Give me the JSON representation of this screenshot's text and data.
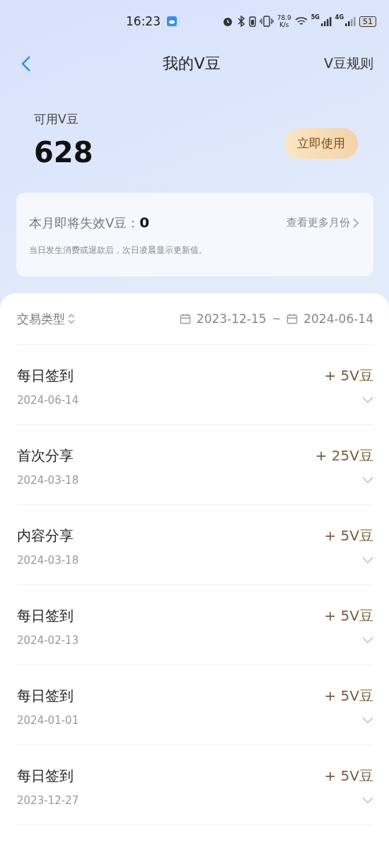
{
  "status_bar": {
    "time": "16:23",
    "speed_value": "78.9",
    "speed_unit": "K/s",
    "network_1": "5G",
    "network_2": "4G",
    "battery": "51"
  },
  "header": {
    "title": "我的V豆",
    "action": "V豆规则"
  },
  "balance": {
    "label": "可用V豆",
    "value": "628",
    "button": "立即使用"
  },
  "expiry_card": {
    "label": "本月即将失效V豆：",
    "value": "0",
    "link": "查看更多月份",
    "note": "当日发生消费或退款后，次日凌晨显示更新值。"
  },
  "filter": {
    "type_label": "交易类型",
    "start_date": "2023-12-15",
    "separator": "~",
    "end_date": "2024-06-14"
  },
  "transactions": [
    {
      "title": "每日签到",
      "date": "2024-06-14",
      "amount": "+ 5V豆",
      "expanded": false
    },
    {
      "title": "首次分享",
      "date": "2024-03-18",
      "amount": "+ 25V豆",
      "expanded": false
    },
    {
      "title": "内容分享",
      "date": "2024-03-18",
      "amount": "+ 5V豆",
      "expanded": false
    },
    {
      "title": "每日签到",
      "date": "2024-02-13",
      "amount": "+ 5V豆",
      "expanded": false
    },
    {
      "title": "每日签到",
      "date": "2024-01-01",
      "amount": "+ 5V豆",
      "expanded": false
    },
    {
      "title": "每日签到",
      "date": "2023-12-27",
      "amount": "+ 5V豆",
      "expanded": false
    }
  ]
}
